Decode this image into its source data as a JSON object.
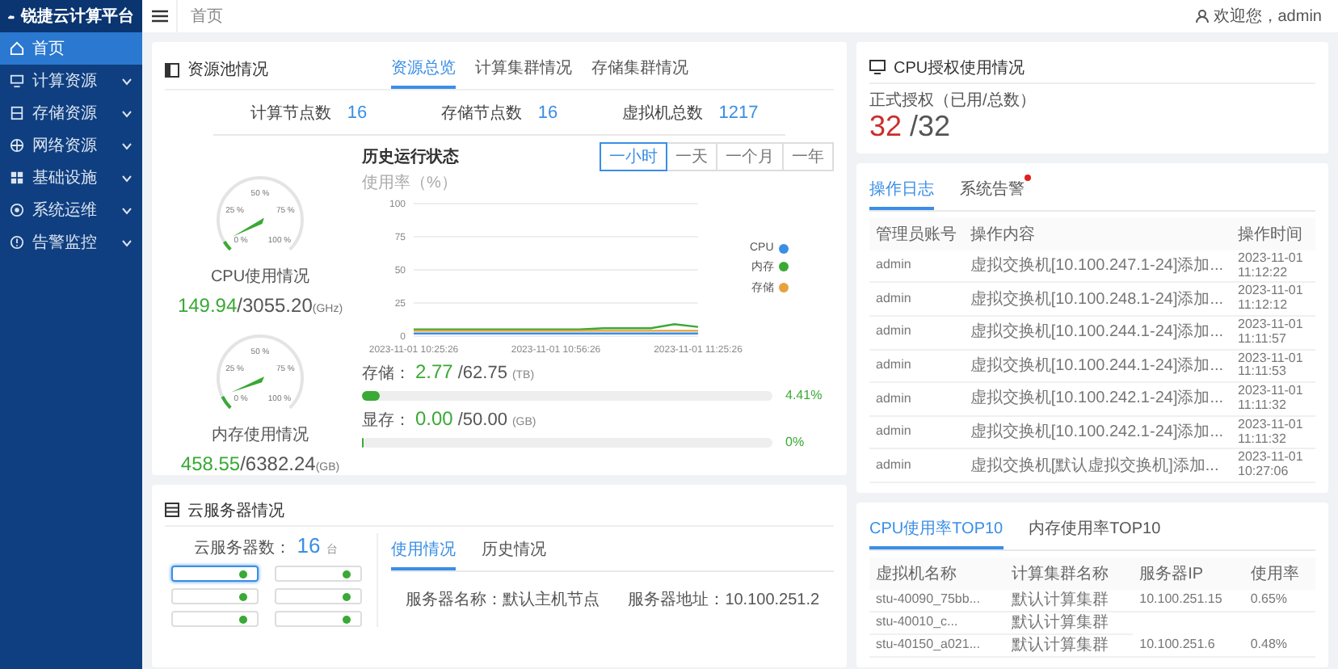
{
  "sidebar": {
    "logo": "锐捷云计算平台",
    "items": [
      {
        "label": "首页",
        "selected": true,
        "expandable": false
      },
      {
        "label": "计算资源",
        "selected": false,
        "expandable": true
      },
      {
        "label": "存储资源",
        "selected": false,
        "expandable": true
      },
      {
        "label": "网络资源",
        "selected": false,
        "expandable": true
      },
      {
        "label": "基础设施",
        "selected": false,
        "expandable": true
      },
      {
        "label": "系统运维",
        "selected": false,
        "expandable": true
      },
      {
        "label": "告警监控",
        "selected": false,
        "expandable": true
      }
    ]
  },
  "header": {
    "breadcrumb": "首页",
    "greeting": "欢迎您，admin"
  },
  "resource_pool": {
    "title": "资源池情况",
    "tabs": [
      {
        "label": "资源总览",
        "selected": true
      },
      {
        "label": "计算集群情况",
        "selected": false
      },
      {
        "label": "存储集群情况",
        "selected": false
      }
    ],
    "counts": [
      {
        "label": "计算节点数",
        "value": "16"
      },
      {
        "label": "存储节点数",
        "value": "16"
      },
      {
        "label": "虚拟机总数",
        "value": "1217"
      }
    ],
    "gauges": [
      {
        "ticks": [
          "0 %",
          "25 %",
          "50 %",
          "75 %",
          "100 %"
        ],
        "level": 0.05,
        "label": "CPU使用情况",
        "used": "149.94",
        "total": "/3055.20",
        "unit": "(GHz)"
      },
      {
        "ticks": [
          "0 %",
          "25 %",
          "50 %",
          "75 %",
          "100 %"
        ],
        "level": 0.07,
        "label": "内存使用情况",
        "used": "458.55",
        "total": "/6382.24",
        "unit": "(GB)"
      }
    ],
    "history": {
      "title": "历史运行状态",
      "ranges": [
        {
          "label": "一小时",
          "selected": true
        },
        {
          "label": "一天",
          "selected": false
        },
        {
          "label": "一个月",
          "selected": false
        },
        {
          "label": "一年",
          "selected": false
        }
      ],
      "chart_data": {
        "type": "line",
        "ylabel": "使用率（%）",
        "categories": [
          "2023-11-01 10:25:26",
          null,
          null,
          null,
          null,
          null,
          "2023-11-01 10:56:26",
          null,
          null,
          null,
          null,
          null,
          "2023-11-01 11:25:26"
        ],
        "ylim": [
          0,
          100
        ],
        "yticks": [
          0,
          25,
          50,
          75,
          100
        ],
        "grid": true,
        "series": [
          {
            "name": "CPU",
            "color": "#3a8ee6",
            "values": [
              2,
              2,
              2,
              2,
              2,
              2,
              2,
              2,
              2,
              2,
              2,
              2,
              2
            ]
          },
          {
            "name": "内存",
            "color": "#3aa935",
            "values": [
              5,
              5,
              5,
              5,
              5,
              5,
              5,
              5,
              6,
              6,
              6,
              9,
              7
            ]
          },
          {
            "name": "存储",
            "color": "#e6a23c",
            "values": [
              4,
              4,
              4,
              4,
              4,
              4,
              4,
              4,
              4,
              4,
              4,
              4,
              4
            ]
          }
        ]
      }
    },
    "storage": [
      {
        "label": "存储：",
        "used": "2.77",
        "total": "/62.75",
        "unit": "(TB)",
        "level": 0.0441,
        "percent": "4.41%"
      },
      {
        "label": "显存：",
        "used": "0.00",
        "total": "/50.00",
        "unit": "(GB)",
        "level": 0,
        "percent": "0%"
      }
    ]
  },
  "license": {
    "title": "CPU授权使用情况",
    "subtitle": "正式授权（已用/总数）",
    "used": "32",
    "total": "/32"
  },
  "logs": {
    "tabs": [
      {
        "label": "操作日志",
        "selected": true,
        "alert": false
      },
      {
        "label": "系统告警",
        "selected": false,
        "alert": true
      }
    ],
    "columns": [
      "管理员账号",
      "操作内容",
      "操作时间"
    ],
    "rows": [
      [
        "admin",
        "虚拟交换机[10.100.247.1-24]添加...",
        "2023-11-01 11:12:22"
      ],
      [
        "admin",
        "虚拟交换机[10.100.248.1-24]添加...",
        "2023-11-01 11:12:12"
      ],
      [
        "admin",
        "虚拟交换机[10.100.244.1-24]添加...",
        "2023-11-01 11:11:57"
      ],
      [
        "admin",
        "虚拟交换机[10.100.244.1-24]添加...",
        "2023-11-01 11:11:53"
      ],
      [
        "admin",
        "虚拟交换机[10.100.242.1-24]添加...",
        "2023-11-01 11:11:32"
      ],
      [
        "admin",
        "虚拟交换机[10.100.242.1-24]添加...",
        "2023-11-01 11:11:32"
      ],
      [
        "admin",
        "虚拟交换机[默认虚拟交换机]添加...",
        "2023-11-01 10:27:06"
      ]
    ]
  },
  "servers": {
    "title": "云服务器情况",
    "count_label": "云服务器数：",
    "count": "16",
    "count_unit": "台",
    "nodes": [
      {
        "selected": true,
        "color": "#3aa935"
      },
      {
        "selected": false,
        "color": "#3aa935"
      },
      {
        "selected": false,
        "color": "#3aa935"
      },
      {
        "selected": false,
        "color": "#3aa935"
      },
      {
        "selected": false,
        "color": "#3aa935"
      },
      {
        "selected": false,
        "color": "#3aa935"
      }
    ],
    "tabs": [
      {
        "label": "使用情况",
        "selected": true
      },
      {
        "label": "历史情况",
        "selected": false
      }
    ],
    "name_info": "服务器名称：默认主机节点",
    "address_info": "服务器地址：10.100.251.2"
  },
  "top10": {
    "tabs": [
      {
        "label": "CPU使用率TOP10",
        "selected": true
      },
      {
        "label": "内存使用率TOP10",
        "selected": false
      }
    ],
    "columns": [
      "虚拟机名称",
      "计算集群名称",
      "服务器IP",
      "使用率"
    ],
    "rows": [
      [
        "stu-40090_75bb...",
        "默认计算集群",
        "10.100.251.15",
        "0.65%"
      ],
      [
        "stu-40010_c...",
        "默认计算集群"
      ],
      [
        "stu-40150_a021...",
        "默认计算集群",
        "10.100.251.6",
        "0.48%"
      ]
    ]
  }
}
